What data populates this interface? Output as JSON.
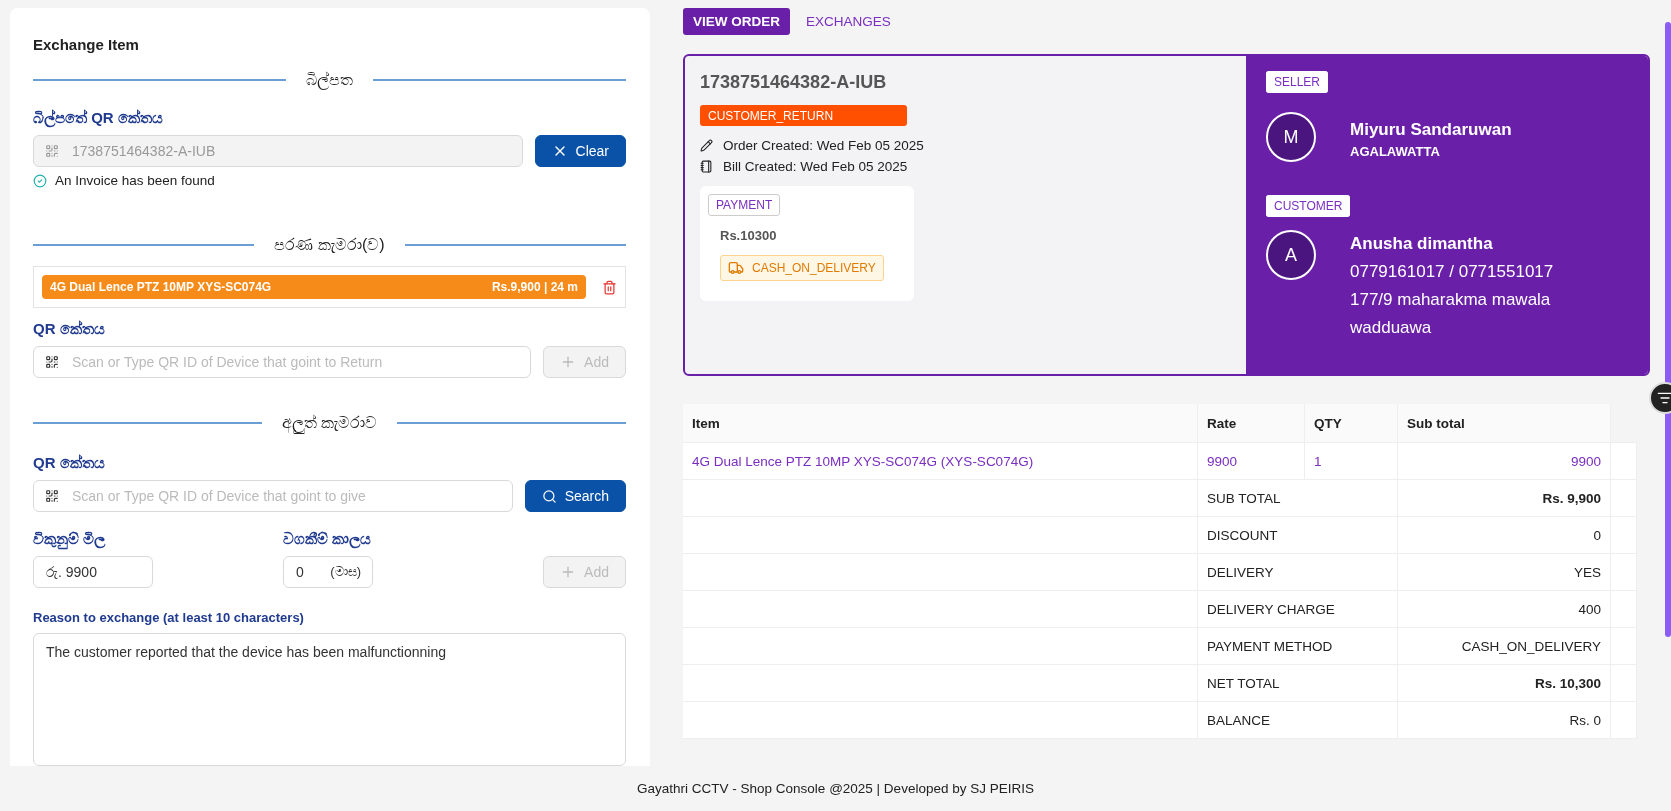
{
  "exchange_panel": {
    "title": "Exchange Item",
    "bill_section": {
      "heading": "බිල්පත",
      "qr_label": "බිල්පතේ QR කේතය",
      "qr_field": {
        "value": "1738751464382-A-IUB",
        "disabled": true
      },
      "clear_button": "Clear",
      "status": "An Invoice has been found"
    },
    "old_section": {
      "heading": "පරණ කැමරා(ව)",
      "items": [
        {
          "name": "4G Dual Lence PTZ 10MP XYS-SC074G",
          "price": "Rs.9,900 | 24 m"
        }
      ],
      "qr_label": "QR කේතය",
      "qr_placeholder": "Scan or Type QR ID of Device that goint to Return",
      "add_button": {
        "label": "Add",
        "disabled": true
      }
    },
    "new_section": {
      "heading": "අලුත් කැමරාව",
      "qr_label": "QR කේතය",
      "qr_placeholder": "Scan or Type QR ID of Device that goint to give",
      "search_button": "Search",
      "price_label": "විකුනුම් මිල",
      "price_value": "රු. 9900",
      "warranty_label": "වගකීම් කාලය",
      "warranty_value": "0",
      "warranty_unit": "(මාස)",
      "add_button": {
        "label": "Add",
        "disabled": true
      }
    },
    "reason": {
      "label": "Reason to exchange (at least 10 characters)",
      "value": "The customer reported that the device has been malfunctionning"
    }
  },
  "tabs": [
    {
      "label": "VIEW ORDER",
      "selected": true
    },
    {
      "label": "EXCHANGES",
      "selected": false
    }
  ],
  "order": {
    "id": "1738751464382-A-IUB",
    "type_badge": "CUSTOMER_RETURN",
    "order_created": "Order Created: Wed Feb 05 2025",
    "bill_created": "Bill Created: Wed Feb 05 2025",
    "payment": {
      "badge": "PAYMENT",
      "amount": "Rs.10300",
      "method": "CASH_ON_DELIVERY"
    },
    "seller": {
      "badge": "SELLER",
      "initial": "M",
      "name": "Miyuru Sandaruwan",
      "location": "AGALAWATTA"
    },
    "customer": {
      "badge": "CUSTOMER",
      "initial": "A",
      "name": "Anusha dimantha",
      "phone": "0779161017 / 0771551017",
      "address": "177/9 maharakma mawala wadduawa"
    }
  },
  "table": {
    "columns": [
      "Item",
      "Rate",
      "QTY",
      "Sub total"
    ],
    "rows": [
      {
        "item": "4G Dual Lence PTZ 10MP XYS-SC074G (XYS-SC074G)",
        "rate": "9900",
        "qty": "1",
        "subtotal": "9900"
      }
    ],
    "summary": [
      {
        "label": "SUB TOTAL",
        "value": "Rs. 9,900",
        "emphasis": true
      },
      {
        "label": "DISCOUNT",
        "value": "0",
        "emphasis": false
      },
      {
        "label": "DELIVERY",
        "value": "YES",
        "emphasis": false
      },
      {
        "label": "DELIVERY CHARGE",
        "value": "400",
        "emphasis": false
      },
      {
        "label": "PAYMENT METHOD",
        "value": "CASH_ON_DELIVERY",
        "emphasis": false
      },
      {
        "label": "NET TOTAL",
        "value": "Rs. 10,300",
        "emphasis": true
      },
      {
        "label": "BALANCE",
        "value": "Rs. 0",
        "emphasis": false
      }
    ]
  },
  "footer": "Gayathri CCTV - Shop Console @2025 | Developed by SJ PEIRIS"
}
